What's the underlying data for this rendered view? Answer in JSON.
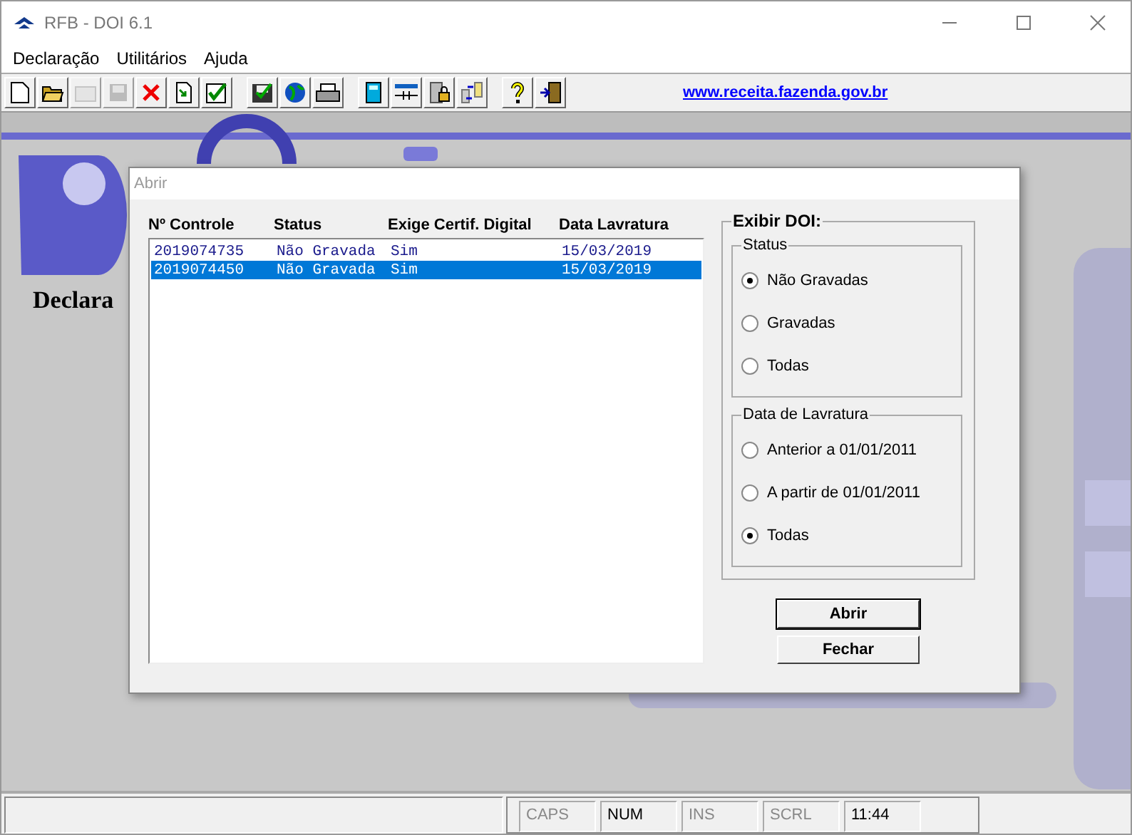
{
  "window": {
    "title": "RFB - DOI 6.1"
  },
  "menu": [
    {
      "label": "Declaração"
    },
    {
      "label": "Utilitários"
    },
    {
      "label": "Ajuda"
    }
  ],
  "toolbar": {
    "groups": [
      [
        {
          "kind": "new",
          "disabled": false
        },
        {
          "kind": "open",
          "disabled": false
        },
        {
          "kind": "folder",
          "disabled": true
        },
        {
          "kind": "save",
          "disabled": true
        },
        {
          "kind": "delete",
          "disabled": false
        },
        {
          "kind": "import",
          "disabled": false
        },
        {
          "kind": "check",
          "disabled": false
        }
      ],
      [
        {
          "kind": "disk",
          "disabled": false
        },
        {
          "kind": "globe",
          "disabled": false
        },
        {
          "kind": "print",
          "disabled": false
        }
      ],
      [
        {
          "kind": "calc",
          "disabled": false
        },
        {
          "kind": "ruler",
          "disabled": false
        },
        {
          "kind": "lock",
          "disabled": false
        },
        {
          "kind": "transfer",
          "disabled": false
        }
      ],
      [
        {
          "kind": "help",
          "disabled": false
        },
        {
          "kind": "exit",
          "disabled": false
        }
      ]
    ],
    "link": "www.receita.fazenda.gov.br"
  },
  "background": {
    "heading": "Declara"
  },
  "dialog": {
    "title": "Abrir",
    "columns": [
      "Nº Controle",
      "Status",
      "Exige Certif. Digital",
      "Data Lavratura"
    ],
    "rows": [
      {
        "cells": [
          "2019074735",
          "Não Gravada",
          "Sim",
          "15/03/2019"
        ],
        "selected": false
      },
      {
        "cells": [
          "2019074450",
          "Não Gravada",
          "Sim",
          "15/03/2019"
        ],
        "selected": true
      }
    ],
    "panel": {
      "title": "Exibir DOI:",
      "groups": [
        {
          "title": "Status",
          "options": [
            {
              "label": "Não Gravadas",
              "selected": true
            },
            {
              "label": "Gravadas",
              "selected": false
            },
            {
              "label": "Todas",
              "selected": false
            }
          ]
        },
        {
          "title": "Data de Lavratura",
          "options": [
            {
              "label": "Anterior a 01/01/2011",
              "selected": false
            },
            {
              "label": "A partir de 01/01/2011",
              "selected": false
            },
            {
              "label": "Todas",
              "selected": true
            }
          ]
        }
      ]
    },
    "buttons": [
      {
        "label": "Abrir",
        "default": true
      },
      {
        "label": "Fechar",
        "default": false
      }
    ]
  },
  "status_bar": {
    "indicators": [
      {
        "label": "CAPS",
        "on": false
      },
      {
        "label": "NUM",
        "on": true
      },
      {
        "label": "INS",
        "on": false
      },
      {
        "label": "SCRL",
        "on": false
      },
      {
        "label": "11:44",
        "on": true
      }
    ]
  }
}
